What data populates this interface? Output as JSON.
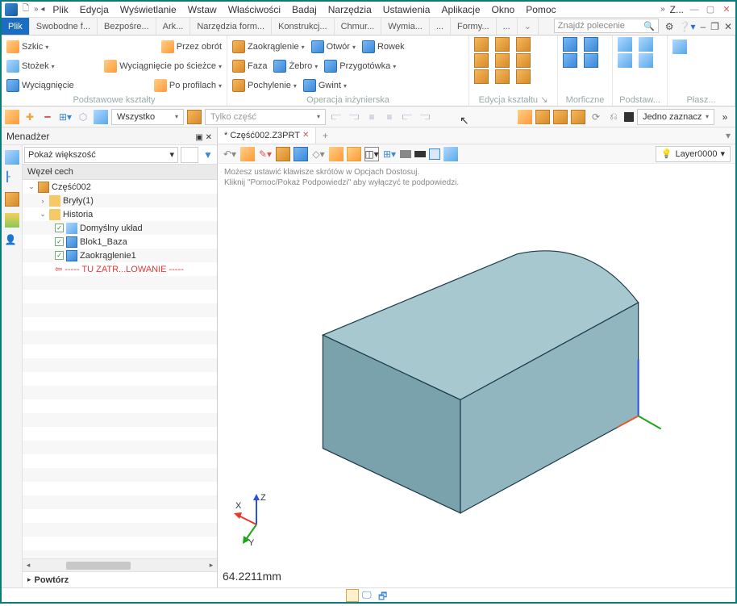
{
  "title_short": "Z...",
  "menu": [
    "Plik",
    "Edycja",
    "Wyświetlanie",
    "Wstaw",
    "Właściwości",
    "Badaj",
    "Narzędzia",
    "Ustawienia",
    "Aplikacje",
    "Okno",
    "Pomoc"
  ],
  "file_tab_active": "Plik",
  "file_tabs": [
    "Swobodne f...",
    "Bezpośre...",
    "Ark...",
    "Narzędzia form...",
    "Konstrukcj...",
    "Chmur...",
    "Wymia...",
    "...",
    "Formy...",
    "..."
  ],
  "search_placeholder": "Znajdź polecenie",
  "ribbon": {
    "group1_label": "Podstawowe kształty",
    "group1": {
      "sketch": "Szkic",
      "revolve": "Przez obrót",
      "cone": "Stożek",
      "sweep": "Wyciągnięcie po ścieżce",
      "extrude": "Wyciągnięcie",
      "loft": "Po profilach"
    },
    "group2_label": "Operacja inżynierska",
    "group2": {
      "fillet": "Zaokrąglenie",
      "hole": "Otwór",
      "slot": "Rowek",
      "chamfer": "Faza",
      "rib": "Żebro",
      "prep": "Przygotówka",
      "draft": "Pochylenie",
      "thread": "Gwint"
    },
    "group3_label": "Edycja kształtu",
    "group4_label": "Morficzne",
    "group5_label": "Podstaw...",
    "group6_label": "Płasz..."
  },
  "secbar": {
    "filter": "Wszystko",
    "scope": "Tylko część",
    "select_mode": "Jedno zaznacz"
  },
  "manager": {
    "title": "Menadżer",
    "show": "Pokaż większość",
    "tree_header": "Węzeł cech",
    "part": "Część002",
    "solids": "Bryły(1)",
    "history": "Historia",
    "feat1": "Domyślny układ",
    "feat2": "Blok1_Baza",
    "feat3": "Zaokrąglenie1",
    "pointer": "----- TU ZATR...LOWANIE -----",
    "repeat": "Powtórz"
  },
  "doc": {
    "name": "Część002.Z3PRT",
    "dirty": "*"
  },
  "hints": {
    "l1": "Możesz ustawić klawisze skrótów w Opcjach Dostosuj.",
    "l2": "Kliknij \"Pomoc/Pokaż Podpowiedzi\" aby wyłączyć te podpowiedzi."
  },
  "layer": "Layer0000",
  "triad": {
    "x": "X",
    "y": "Y",
    "z": "Z"
  },
  "measure": "64.2211mm"
}
